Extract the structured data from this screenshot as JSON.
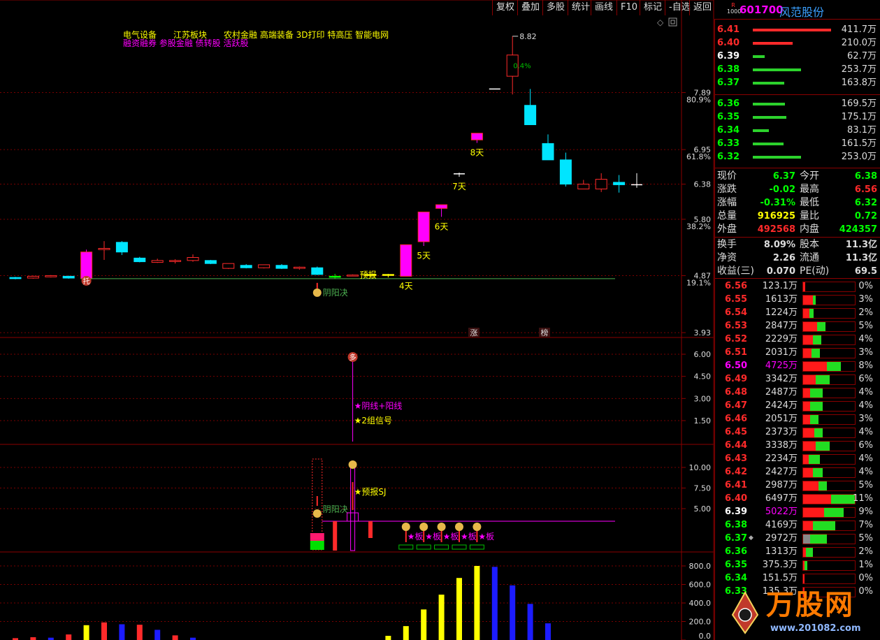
{
  "toolbar": {
    "items": [
      "复权",
      "叠加",
      "多股",
      "统计",
      "画线",
      "F10",
      "标记",
      "-自选",
      "返回"
    ]
  },
  "stock": {
    "code": "601700",
    "name": "风范股份",
    "badge_top": "R",
    "badge_bottom": "1000"
  },
  "concepts": {
    "line1": "电气设备　　江苏板块　　农村金融 高端装备 3D打印 特高压 智能电网",
    "line2": "融资融券 参股金融 债转股 活跃股"
  },
  "colors": {
    "up": "#ff2a2a",
    "down": "#00e5ff",
    "magenta": "#ff00ff",
    "yellow": "#ffff00",
    "green": "#00ff00",
    "border": "#8b0000",
    "blue": "#1c1cff"
  },
  "chart_data": [
    {
      "type": "candlestick",
      "title": "",
      "y_labels": [
        "7.89",
        "6.95",
        "6.38",
        "5.80",
        "4.87",
        "3.93"
      ],
      "pct_labels": [
        "80.9%",
        "61.8%",
        "38.2%",
        "19.1%"
      ],
      "high_label": "8.82",
      "candles": [
        {
          "o": 4.84,
          "c": 4.82,
          "h": 4.85,
          "l": 4.81
        },
        {
          "o": 4.83,
          "c": 4.86,
          "h": 4.87,
          "l": 4.82
        },
        {
          "o": 4.85,
          "c": 4.87,
          "h": 4.88,
          "l": 4.84
        },
        {
          "o": 4.86,
          "c": 4.83,
          "h": 4.87,
          "l": 4.82
        },
        {
          "o": 4.82,
          "c": 5.26,
          "h": 5.3,
          "l": 4.8,
          "fill": "magenta"
        },
        {
          "o": 5.3,
          "c": 5.32,
          "h": 5.44,
          "l": 5.13
        },
        {
          "o": 5.42,
          "c": 5.26,
          "h": 5.44,
          "l": 5.21
        },
        {
          "o": 5.16,
          "c": 5.1,
          "h": 5.18,
          "l": 5.09
        },
        {
          "o": 5.09,
          "c": 5.12,
          "h": 5.15,
          "l": 5.08
        },
        {
          "o": 5.11,
          "c": 5.12,
          "h": 5.14,
          "l": 5.07
        },
        {
          "o": 5.12,
          "c": 5.17,
          "h": 5.22,
          "l": 5.1
        },
        {
          "o": 5.12,
          "c": 5.07,
          "h": 5.13,
          "l": 5.06
        },
        {
          "o": 4.99,
          "c": 5.07,
          "h": 5.07,
          "l": 4.98
        },
        {
          "o": 5.04,
          "c": 5.0,
          "h": 5.06,
          "l": 4.99
        },
        {
          "o": 5.0,
          "c": 5.05,
          "h": 5.05,
          "l": 4.99
        },
        {
          "o": 5.04,
          "c": 4.99,
          "h": 5.06,
          "l": 4.98
        },
        {
          "o": 4.99,
          "c": 5.01,
          "h": 5.02,
          "l": 4.97
        },
        {
          "o": 5.0,
          "c": 4.89,
          "h": 5.02,
          "l": 4.88
        },
        {
          "o": 4.86,
          "c": 4.86,
          "h": 4.9,
          "l": 4.82,
          "fill": "green"
        },
        {
          "o": 4.88,
          "c": 4.88,
          "h": 4.89,
          "l": 4.86
        },
        {
          "o": 4.89,
          "c": 4.89,
          "h": 4.9,
          "l": 4.84,
          "fill": "yellow"
        },
        {
          "o": 4.89,
          "c": 4.89,
          "h": 4.9,
          "l": 4.84,
          "fill": "yellow"
        },
        {
          "o": 4.86,
          "c": 5.38,
          "h": 5.38,
          "l": 4.86,
          "fill": "magenta"
        },
        {
          "o": 5.43,
          "c": 5.92,
          "h": 5.92,
          "l": 5.36,
          "fill": "magenta"
        },
        {
          "o": 5.98,
          "c": 6.04,
          "h": 6.04,
          "l": 5.84,
          "fill": "magenta"
        },
        {
          "o": 6.55,
          "c": 6.55,
          "h": 6.57,
          "l": 6.5,
          "fill": "cross"
        },
        {
          "o": 7.11,
          "c": 7.22,
          "h": 7.22,
          "l": 7.06,
          "fill": "magenta"
        },
        {
          "o": 7.95,
          "c": 7.95,
          "h": 7.95,
          "l": 7.95,
          "fill": "cross"
        },
        {
          "o": 8.16,
          "c": 8.51,
          "h": 8.82,
          "l": 7.86
        },
        {
          "o": 7.68,
          "c": 7.36,
          "h": 7.95,
          "l": 7.36
        },
        {
          "o": 7.05,
          "c": 6.78,
          "h": 7.2,
          "l": 6.78
        },
        {
          "o": 6.78,
          "c": 6.38,
          "h": 6.9,
          "l": 6.34
        },
        {
          "o": 6.3,
          "c": 6.38,
          "h": 6.45,
          "l": 6.3
        },
        {
          "o": 6.3,
          "c": 6.46,
          "h": 6.56,
          "l": 6.25
        },
        {
          "o": 6.41,
          "c": 6.37,
          "h": 6.53,
          "l": 6.24
        },
        {
          "o": 6.37,
          "c": 6.37,
          "h": 6.56,
          "l": 6.32,
          "fill": "cross"
        }
      ],
      "annotations": {
        "tuo": "托",
        "yinyang": "阴阳决",
        "yubao": "预报",
        "days": [
          "4天",
          "5天",
          "6天",
          "7天",
          "8天"
        ],
        "pct_mark": "0.4%",
        "zhang": "涨",
        "bang": "榜"
      }
    },
    {
      "type": "indicator",
      "y_labels": [
        "6.00",
        "4.50",
        "3.00",
        "1.50"
      ],
      "marker": "多",
      "labels": [
        "★阴线+阳线",
        "★2组信号"
      ]
    },
    {
      "type": "indicator",
      "y_labels": [
        "10.00",
        "7.50",
        "5.00"
      ],
      "labels": [
        "阴阳决",
        "★预报SJ"
      ],
      "ban": "★板"
    },
    {
      "type": "bar",
      "y_labels": [
        "800.0",
        "600.0",
        "400.0",
        "200.0",
        "0.0"
      ],
      "ylim": [
        0,
        800
      ],
      "bars": [
        {
          "v": 20,
          "c": "red"
        },
        {
          "v": 30,
          "c": "red"
        },
        {
          "v": 25,
          "c": "blue"
        },
        {
          "v": 60,
          "c": "red"
        },
        {
          "v": 160,
          "c": "yellow"
        },
        {
          "v": 190,
          "c": "red"
        },
        {
          "v": 170,
          "c": "blue"
        },
        {
          "v": 165,
          "c": "red"
        },
        {
          "v": 110,
          "c": "blue"
        },
        {
          "v": 50,
          "c": "red"
        },
        {
          "v": 25,
          "c": "blue"
        },
        {
          "v": 45,
          "c": "yellow"
        },
        {
          "v": 150,
          "c": "yellow"
        },
        {
          "v": 330,
          "c": "yellow"
        },
        {
          "v": 490,
          "c": "yellow"
        },
        {
          "v": 670,
          "c": "yellow"
        },
        {
          "v": 800,
          "c": "yellow"
        },
        {
          "v": 790,
          "c": "blue"
        },
        {
          "v": 590,
          "c": "blue"
        },
        {
          "v": 390,
          "c": "blue"
        },
        {
          "v": 180,
          "c": "blue"
        }
      ]
    }
  ],
  "orderbook": {
    "asks": [
      {
        "p": "6.41",
        "v": "411.7万",
        "w": 411.7
      },
      {
        "p": "6.40",
        "v": "210.0万",
        "w": 210.0
      },
      {
        "p": "6.39",
        "v": "62.7万",
        "w": 62.7
      },
      {
        "p": "6.38",
        "v": "253.7万",
        "w": 253.7
      },
      {
        "p": "6.37",
        "v": "163.8万",
        "w": 163.8
      }
    ],
    "bids": [
      {
        "p": "6.36",
        "v": "169.5万",
        "w": 169.5
      },
      {
        "p": "6.35",
        "v": "175.1万",
        "w": 175.1
      },
      {
        "p": "6.34",
        "v": "83.1万",
        "w": 83.1
      },
      {
        "p": "6.33",
        "v": "161.5万",
        "w": 161.5
      },
      {
        "p": "6.32",
        "v": "253.0万",
        "w": 253.0
      }
    ]
  },
  "quote": {
    "rows": [
      {
        "l1": "现价",
        "v1": "6.37",
        "c1": "#00ff00",
        "l2": "今开",
        "v2": "6.38",
        "c2": "#00ff00"
      },
      {
        "l1": "涨跌",
        "v1": "-0.02",
        "c1": "#00ff00",
        "l2": "最高",
        "v2": "6.56",
        "c2": "#ff2a2a"
      },
      {
        "l1": "涨幅",
        "v1": "-0.31%",
        "c1": "#00ff00",
        "l2": "最低",
        "v2": "6.32",
        "c2": "#00ff00"
      },
      {
        "l1": "总量",
        "v1": "916925",
        "c1": "#ffff00",
        "l2": "量比",
        "v2": "0.72",
        "c2": "#00ff00"
      },
      {
        "l1": "外盘",
        "v1": "492568",
        "c1": "#ff2a2a",
        "l2": "内盘",
        "v2": "424357",
        "c2": "#00ff00"
      }
    ],
    "rows2": [
      {
        "l1": "换手",
        "v1": "8.09%",
        "l2": "股本",
        "v2": "11.3亿"
      },
      {
        "l1": "净资",
        "v1": "2.26",
        "l2": "流通",
        "v2": "11.3亿"
      },
      {
        "l1": "收益(三)",
        "v1": "0.070",
        "l2": "PE(动)",
        "v2": "69.5"
      }
    ]
  },
  "volume_profile": [
    {
      "p": "6.56",
      "v": "123.1万",
      "pct": "0%",
      "r": 3,
      "g": 0,
      "pc": "#ff2a2a"
    },
    {
      "p": "6.55",
      "v": "1613万",
      "pct": "3%",
      "r": 14,
      "g": 4,
      "pc": "#ff2a2a"
    },
    {
      "p": "6.54",
      "v": "1224万",
      "pct": "2%",
      "r": 9,
      "g": 6,
      "pc": "#ff2a2a"
    },
    {
      "p": "6.53",
      "v": "2847万",
      "pct": "5%",
      "r": 20,
      "g": 12,
      "pc": "#ff2a2a"
    },
    {
      "p": "6.52",
      "v": "2229万",
      "pct": "4%",
      "r": 14,
      "g": 12,
      "pc": "#ff2a2a"
    },
    {
      "p": "6.51",
      "v": "2031万",
      "pct": "3%",
      "r": 12,
      "g": 12,
      "pc": "#ff2a2a"
    },
    {
      "p": "6.50",
      "v": "4725万",
      "pct": "8%",
      "r": 34,
      "g": 20,
      "pc": "#ff00ff"
    },
    {
      "p": "6.49",
      "v": "3342万",
      "pct": "6%",
      "r": 18,
      "g": 20,
      "pc": "#ff2a2a"
    },
    {
      "p": "6.48",
      "v": "2487万",
      "pct": "4%",
      "r": 10,
      "g": 18,
      "pc": "#ff2a2a"
    },
    {
      "p": "6.47",
      "v": "2424万",
      "pct": "4%",
      "r": 10,
      "g": 18,
      "pc": "#ff2a2a"
    },
    {
      "p": "6.46",
      "v": "2051万",
      "pct": "3%",
      "r": 10,
      "g": 12,
      "pc": "#ff2a2a"
    },
    {
      "p": "6.45",
      "v": "2373万",
      "pct": "4%",
      "r": 16,
      "g": 12,
      "pc": "#ff2a2a"
    },
    {
      "p": "6.44",
      "v": "3338万",
      "pct": "6%",
      "r": 18,
      "g": 20,
      "pc": "#ff2a2a"
    },
    {
      "p": "6.43",
      "v": "2234万",
      "pct": "4%",
      "r": 8,
      "g": 16,
      "pc": "#ff2a2a"
    },
    {
      "p": "6.42",
      "v": "2427万",
      "pct": "4%",
      "r": 14,
      "g": 14,
      "pc": "#ff2a2a"
    },
    {
      "p": "6.41",
      "v": "2987万",
      "pct": "5%",
      "r": 22,
      "g": 12,
      "pc": "#ff2a2a"
    },
    {
      "p": "6.40",
      "v": "6497万",
      "pct": "11%",
      "r": 40,
      "g": 34,
      "pc": "#ff2a2a"
    },
    {
      "p": "6.39",
      "v": "5022万",
      "pct": "9%",
      "r": 30,
      "g": 28,
      "pc": "#ffffff"
    },
    {
      "p": "6.38",
      "v": "4169万",
      "pct": "7%",
      "r": 14,
      "g": 32,
      "pc": "#00ff00"
    },
    {
      "p": "6.37",
      "v": "2972万",
      "pct": "5%",
      "r": 10,
      "g": 24,
      "pc": "#00ff00",
      "mark": "◆",
      "gray": true
    },
    {
      "p": "6.36",
      "v": "1313万",
      "pct": "2%",
      "r": 4,
      "g": 10,
      "pc": "#00ff00"
    },
    {
      "p": "6.35",
      "v": "375.3万",
      "pct": "1%",
      "r": 2,
      "g": 4,
      "pc": "#00ff00"
    },
    {
      "p": "6.34",
      "v": "151.5万",
      "pct": "0%",
      "r": 2,
      "g": 0,
      "pc": "#00ff00"
    },
    {
      "p": "6.33",
      "v": "135.3万",
      "pct": "0%",
      "r": 2,
      "g": 0,
      "pc": "#00ff00"
    }
  ],
  "watermark": {
    "brand": "万股网",
    "url": "www.201082.com"
  }
}
